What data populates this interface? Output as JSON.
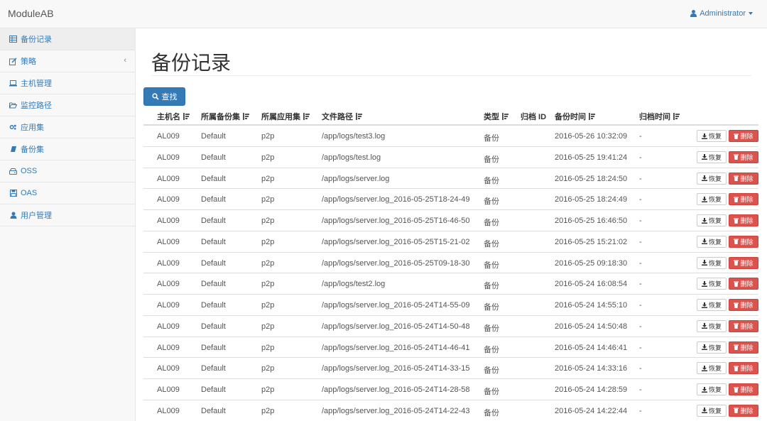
{
  "app": {
    "brand": "ModuleAB"
  },
  "user": {
    "name": "Administrator"
  },
  "sidebar": {
    "items": [
      {
        "label": "备份记录",
        "icon": "table-icon",
        "active": true
      },
      {
        "label": "策略",
        "icon": "edit-icon",
        "expandable": true
      },
      {
        "label": "主机管理",
        "icon": "laptop-icon"
      },
      {
        "label": "监控路径",
        "icon": "folder-open-icon"
      },
      {
        "label": "应用集",
        "icon": "cogs-icon"
      },
      {
        "label": "备份集",
        "icon": "book-icon"
      },
      {
        "label": "OSS",
        "icon": "hdd-icon"
      },
      {
        "label": "OAS",
        "icon": "floppy-disk-icon"
      },
      {
        "label": "用户管理",
        "icon": "user-icon"
      }
    ],
    "expand_glyph": "‹"
  },
  "page": {
    "title": "备份记录",
    "search_label": "查找"
  },
  "table": {
    "columns": [
      "主机名",
      "所属备份集",
      "所属应用集",
      "文件路径",
      "类型",
      "归档 ID",
      "备份时间",
      "归档时间"
    ],
    "sortable": [
      true,
      true,
      true,
      true,
      true,
      false,
      true,
      true
    ],
    "restore_label": "恢复",
    "delete_label": "删除",
    "rows": [
      [
        "AL009",
        "Default",
        "p2p",
        "/app/logs/test3.log",
        "备份",
        "",
        "2016-05-26 10:32:09",
        "-"
      ],
      [
        "AL009",
        "Default",
        "p2p",
        "/app/logs/test.log",
        "备份",
        "",
        "2016-05-25 19:41:24",
        "-"
      ],
      [
        "AL009",
        "Default",
        "p2p",
        "/app/logs/server.log",
        "备份",
        "",
        "2016-05-25 18:24:50",
        "-"
      ],
      [
        "AL009",
        "Default",
        "p2p",
        "/app/logs/server.log_2016-05-25T18-24-49",
        "备份",
        "",
        "2016-05-25 18:24:49",
        "-"
      ],
      [
        "AL009",
        "Default",
        "p2p",
        "/app/logs/server.log_2016-05-25T16-46-50",
        "备份",
        "",
        "2016-05-25 16:46:50",
        "-"
      ],
      [
        "AL009",
        "Default",
        "p2p",
        "/app/logs/server.log_2016-05-25T15-21-02",
        "备份",
        "",
        "2016-05-25 15:21:02",
        "-"
      ],
      [
        "AL009",
        "Default",
        "p2p",
        "/app/logs/server.log_2016-05-25T09-18-30",
        "备份",
        "",
        "2016-05-25 09:18:30",
        "-"
      ],
      [
        "AL009",
        "Default",
        "p2p",
        "/app/logs/test2.log",
        "备份",
        "",
        "2016-05-24 16:08:54",
        "-"
      ],
      [
        "AL009",
        "Default",
        "p2p",
        "/app/logs/server.log_2016-05-24T14-55-09",
        "备份",
        "",
        "2016-05-24 14:55:10",
        "-"
      ],
      [
        "AL009",
        "Default",
        "p2p",
        "/app/logs/server.log_2016-05-24T14-50-48",
        "备份",
        "",
        "2016-05-24 14:50:48",
        "-"
      ],
      [
        "AL009",
        "Default",
        "p2p",
        "/app/logs/server.log_2016-05-24T14-46-41",
        "备份",
        "",
        "2016-05-24 14:46:41",
        "-"
      ],
      [
        "AL009",
        "Default",
        "p2p",
        "/app/logs/server.log_2016-05-24T14-33-15",
        "备份",
        "",
        "2016-05-24 14:33:16",
        "-"
      ],
      [
        "AL009",
        "Default",
        "p2p",
        "/app/logs/server.log_2016-05-24T14-28-58",
        "备份",
        "",
        "2016-05-24 14:28:59",
        "-"
      ],
      [
        "AL009",
        "Default",
        "p2p",
        "/app/logs/server.log_2016-05-24T14-22-43",
        "备份",
        "",
        "2016-05-24 14:22:44",
        "-"
      ]
    ]
  },
  "colors": {
    "primary": "#337ab7",
    "danger": "#d9534f",
    "sidebar_bg": "#f8f8f8"
  }
}
